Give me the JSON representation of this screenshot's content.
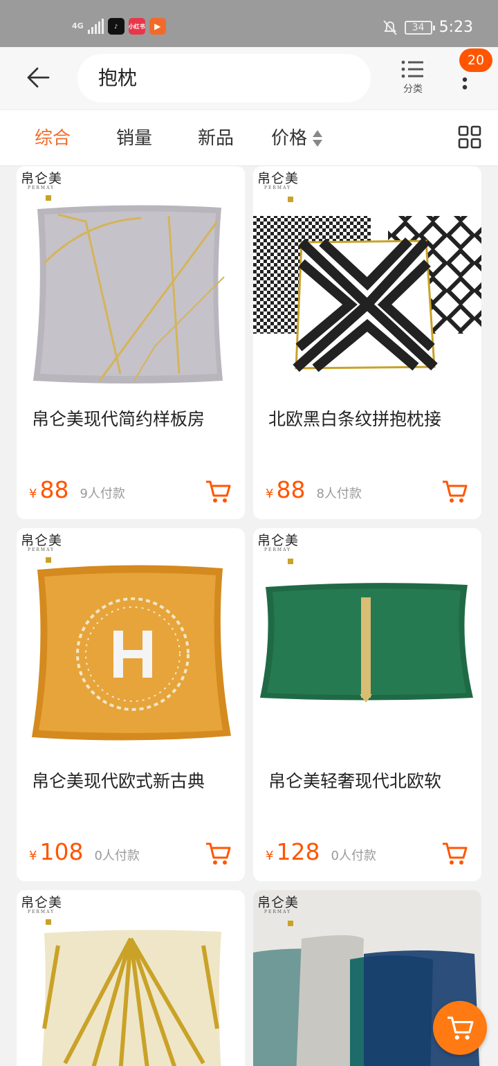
{
  "status_bar": {
    "network": "4G",
    "battery": "34",
    "time": "5:23",
    "apps": [
      "tiktok-icon",
      "xiaohongshu-icon",
      "video-icon"
    ],
    "app_label_xhs": "小红书"
  },
  "header": {
    "search_value": "抱枕",
    "category_label": "分类",
    "badge_count": "20"
  },
  "sort_tabs": [
    {
      "label": "综合",
      "active": true
    },
    {
      "label": "销量",
      "active": false
    },
    {
      "label": "新品",
      "active": false
    },
    {
      "label": "价格",
      "active": false
    }
  ],
  "brand": {
    "name": "帛仑美",
    "sub": "PERMAY"
  },
  "products": [
    {
      "title": "帛仑美现代简约样板房",
      "currency": "¥",
      "price": "88",
      "paid": "9人付款"
    },
    {
      "title": "北欧黑白条纹拼抱枕接",
      "currency": "¥",
      "price": "88",
      "paid": "8人付款"
    },
    {
      "title": "帛仑美现代欧式新古典",
      "currency": "¥",
      "price": "108",
      "paid": "0人付款"
    },
    {
      "title": "帛仑美轻奢现代北欧软",
      "currency": "¥",
      "price": "128",
      "paid": "0人付款"
    },
    {
      "title": "",
      "currency": "",
      "price": "",
      "paid": ""
    },
    {
      "title": "",
      "currency": "",
      "price": "",
      "paid": ""
    }
  ],
  "colors": {
    "accent": "#f06d2e",
    "price": "#ff5500",
    "fab": "#ff7a12"
  }
}
